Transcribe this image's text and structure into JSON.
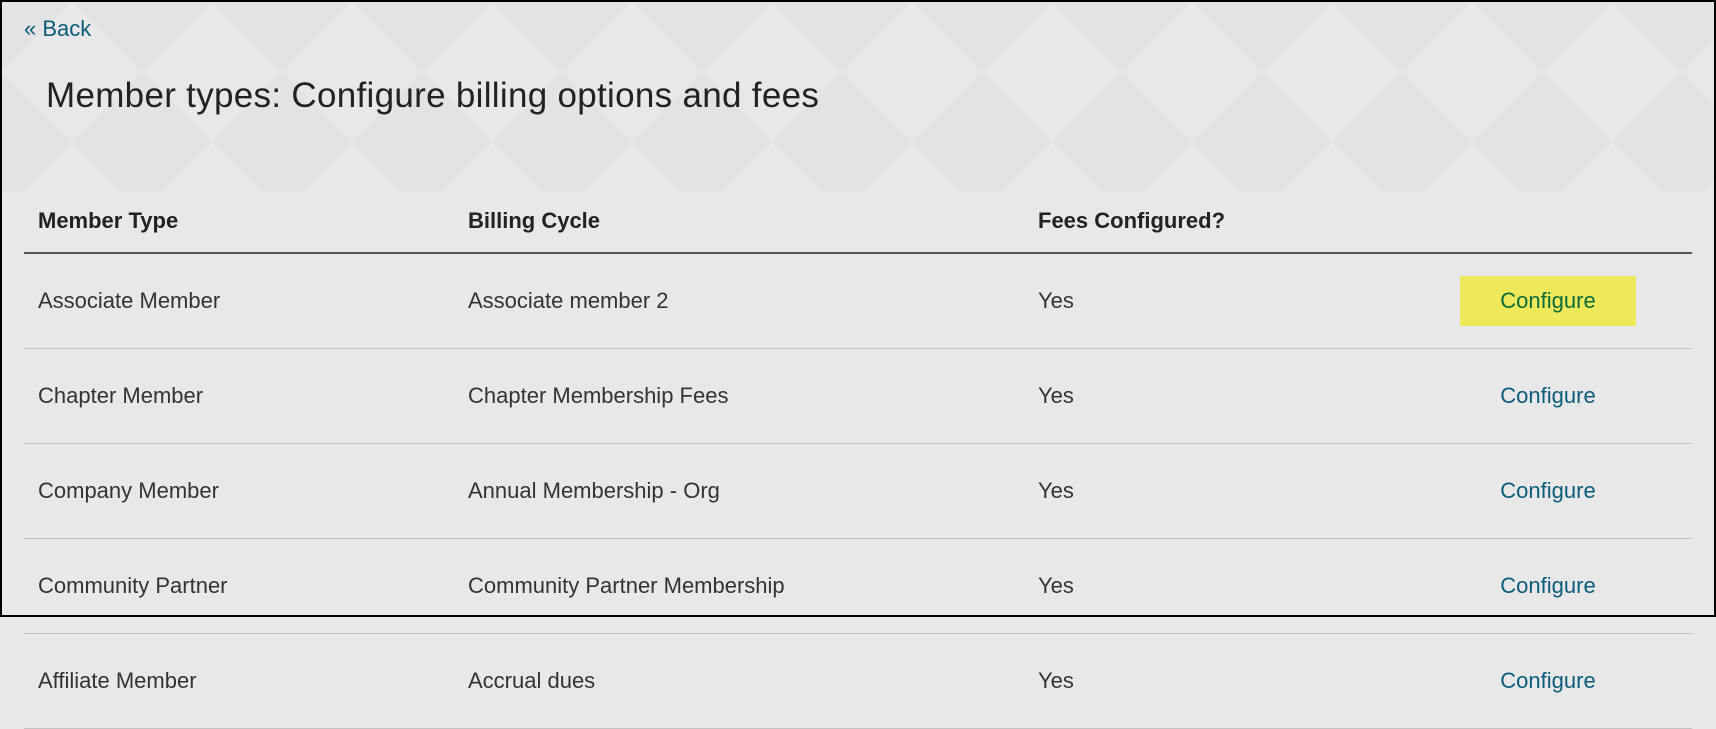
{
  "back": {
    "label": "« Back"
  },
  "page": {
    "title": "Member types: Configure billing options and fees"
  },
  "table": {
    "headers": {
      "member_type": "Member Type",
      "billing_cycle": "Billing Cycle",
      "fees_configured": "Fees Configured?"
    },
    "action_label": "Configure",
    "rows": [
      {
        "member_type": "Associate Member",
        "billing_cycle": "Associate member 2",
        "fees_configured": "Yes",
        "highlight": true
      },
      {
        "member_type": "Chapter Member",
        "billing_cycle": "Chapter Membership Fees",
        "fees_configured": "Yes",
        "highlight": false
      },
      {
        "member_type": "Company Member",
        "billing_cycle": "Annual Membership - Org",
        "fees_configured": "Yes",
        "highlight": false
      },
      {
        "member_type": "Community Partner",
        "billing_cycle": "Community Partner Membership",
        "fees_configured": "Yes",
        "highlight": false
      },
      {
        "member_type": "Affiliate Member",
        "billing_cycle": "Accrual dues",
        "fees_configured": "Yes",
        "highlight": false
      }
    ]
  }
}
